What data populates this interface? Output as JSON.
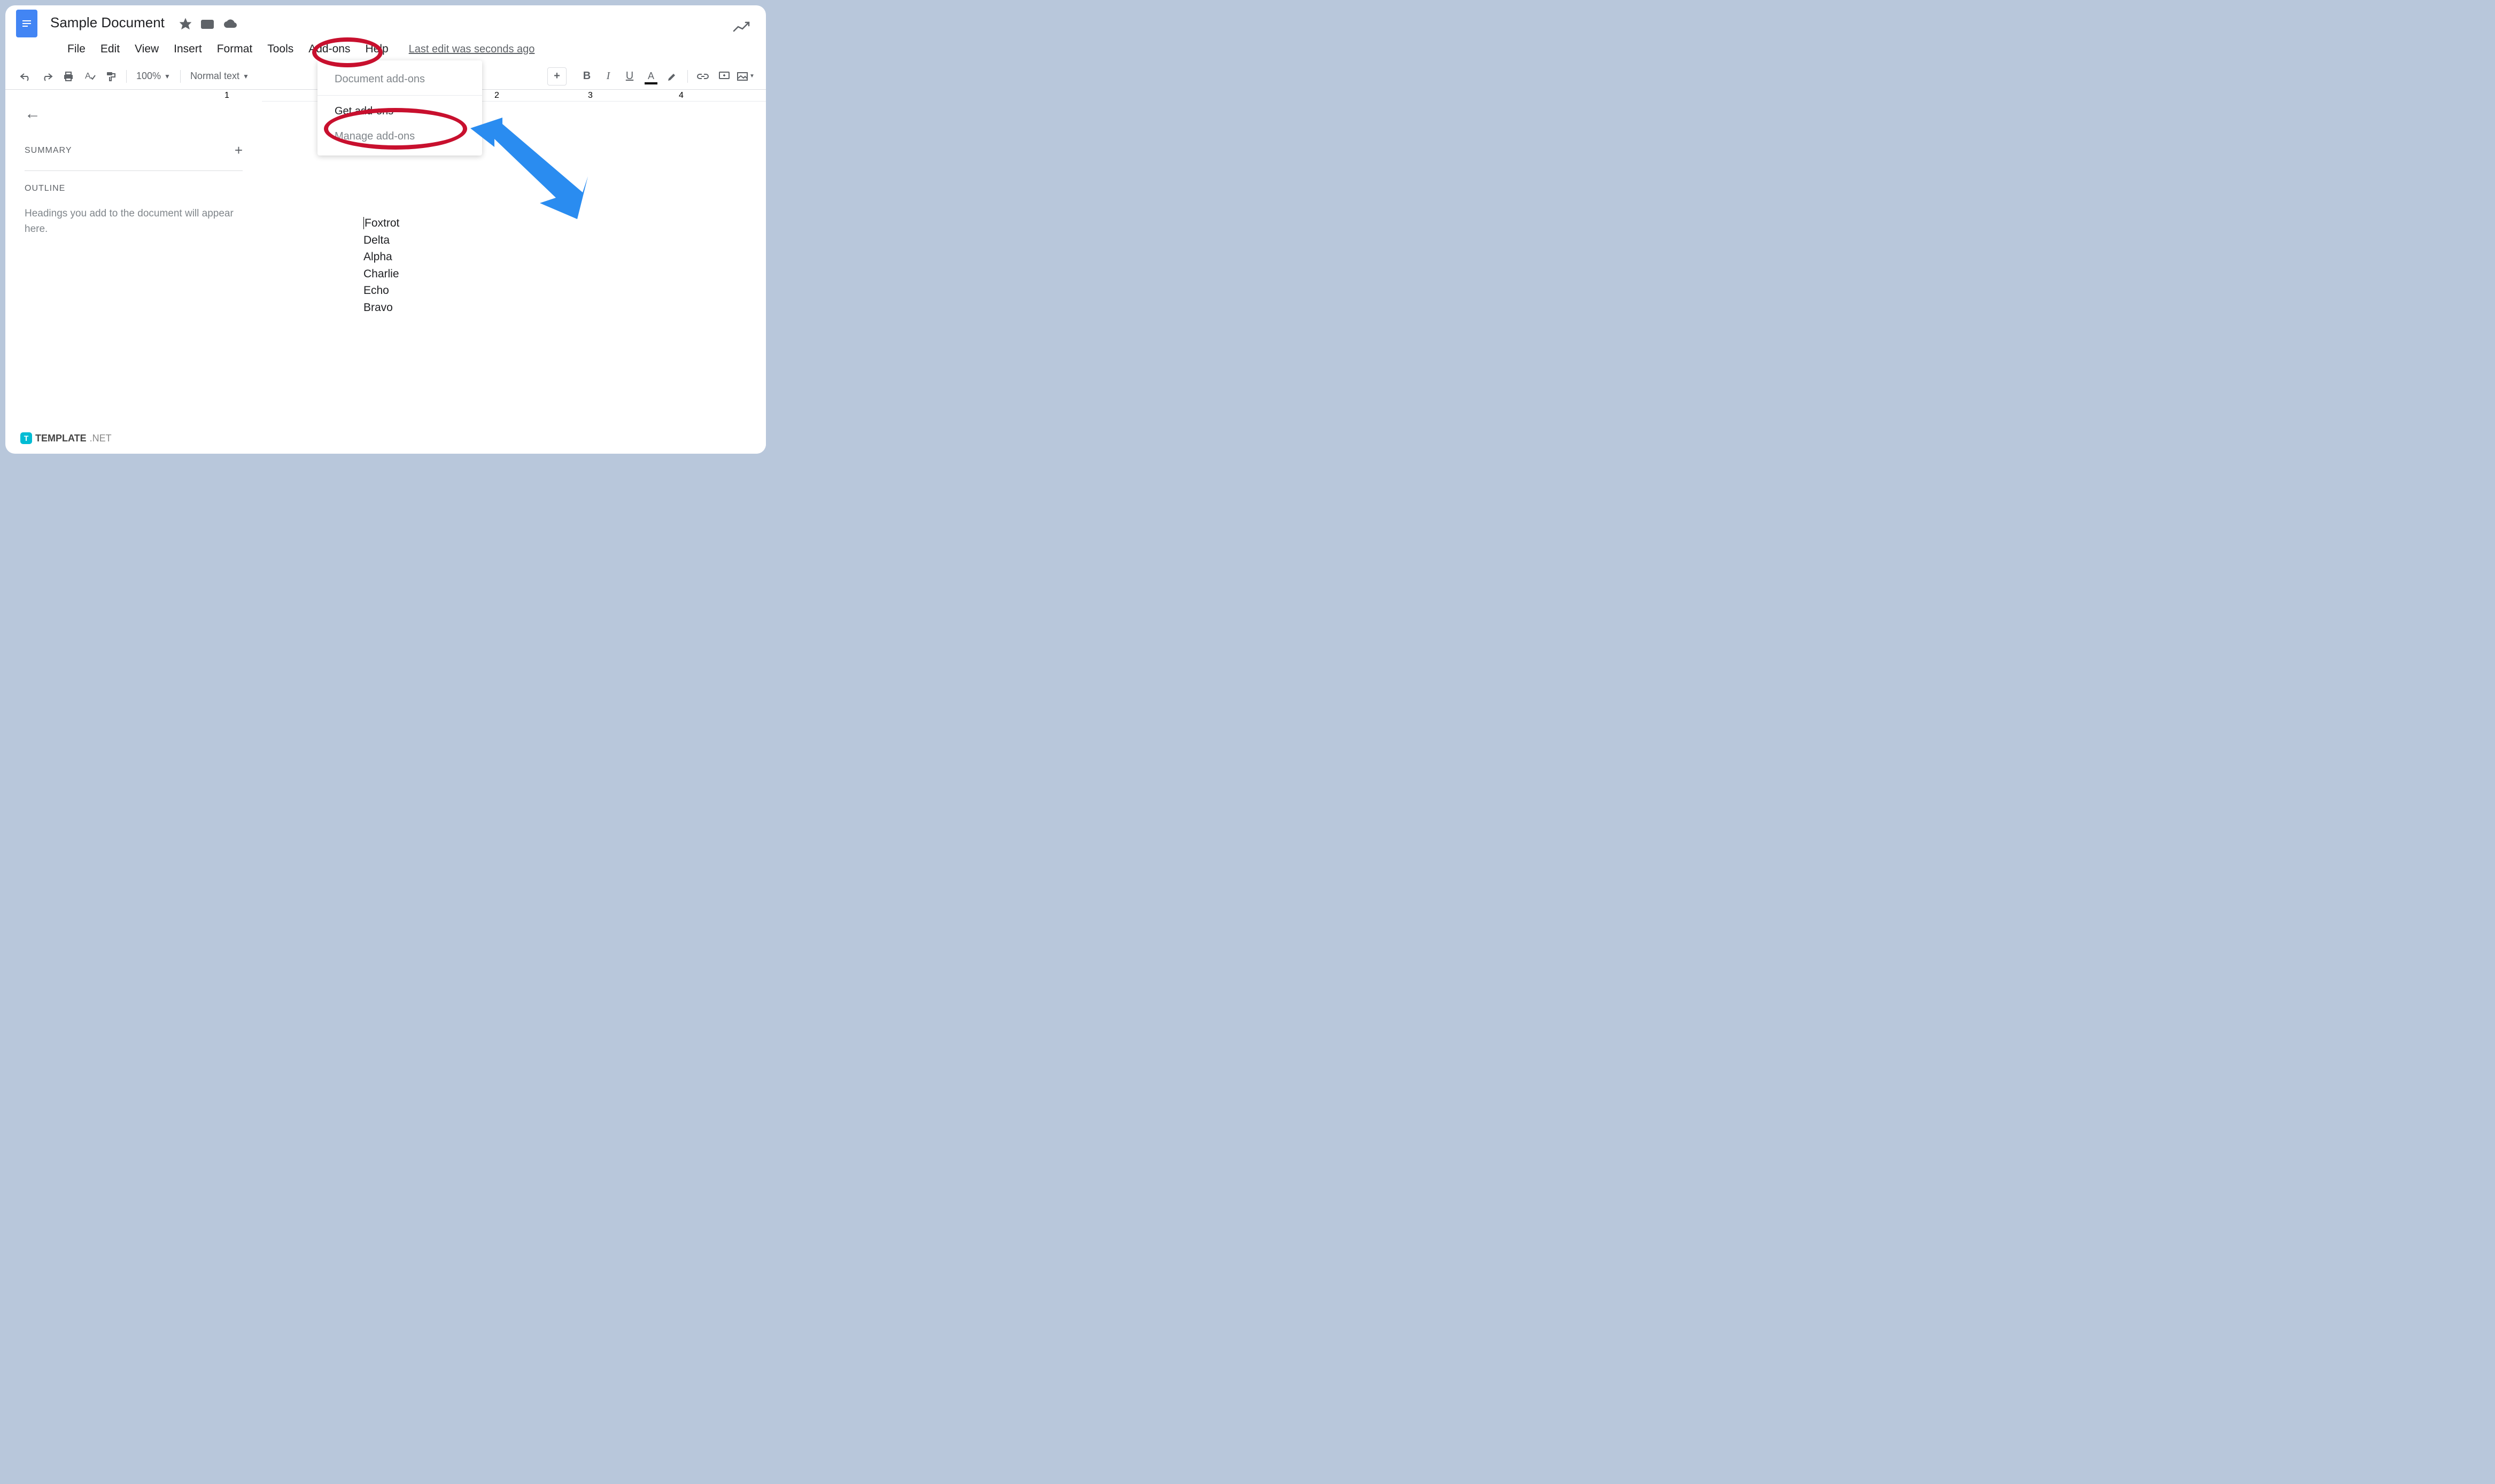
{
  "header": {
    "doc_title": "Sample Document",
    "last_edit": "Last edit was seconds ago"
  },
  "menu": {
    "items": [
      "File",
      "Edit",
      "View",
      "Insert",
      "Format",
      "Tools",
      "Add-ons",
      "Help"
    ]
  },
  "toolbar": {
    "zoom": "100%",
    "style": "Normal text"
  },
  "sidebar": {
    "summary_label": "SUMMARY",
    "outline_label": "OUTLINE",
    "outline_hint": "Headings you add to the document will appear here."
  },
  "dropdown": {
    "items": [
      {
        "label": "Document add-ons",
        "enabled": false
      },
      {
        "label": "Get add-ons",
        "enabled": true
      },
      {
        "label": "Manage add-ons",
        "enabled": false
      }
    ]
  },
  "document": {
    "lines": [
      "Foxtrot",
      "Delta",
      "Alpha",
      "Charlie",
      "Echo",
      "Bravo"
    ]
  },
  "ruler": {
    "ticks": [
      "1",
      "2",
      "3",
      "4"
    ]
  },
  "watermark": {
    "brand": "TEMPLATE",
    "suffix": ".NET",
    "logo_letter": "T"
  }
}
